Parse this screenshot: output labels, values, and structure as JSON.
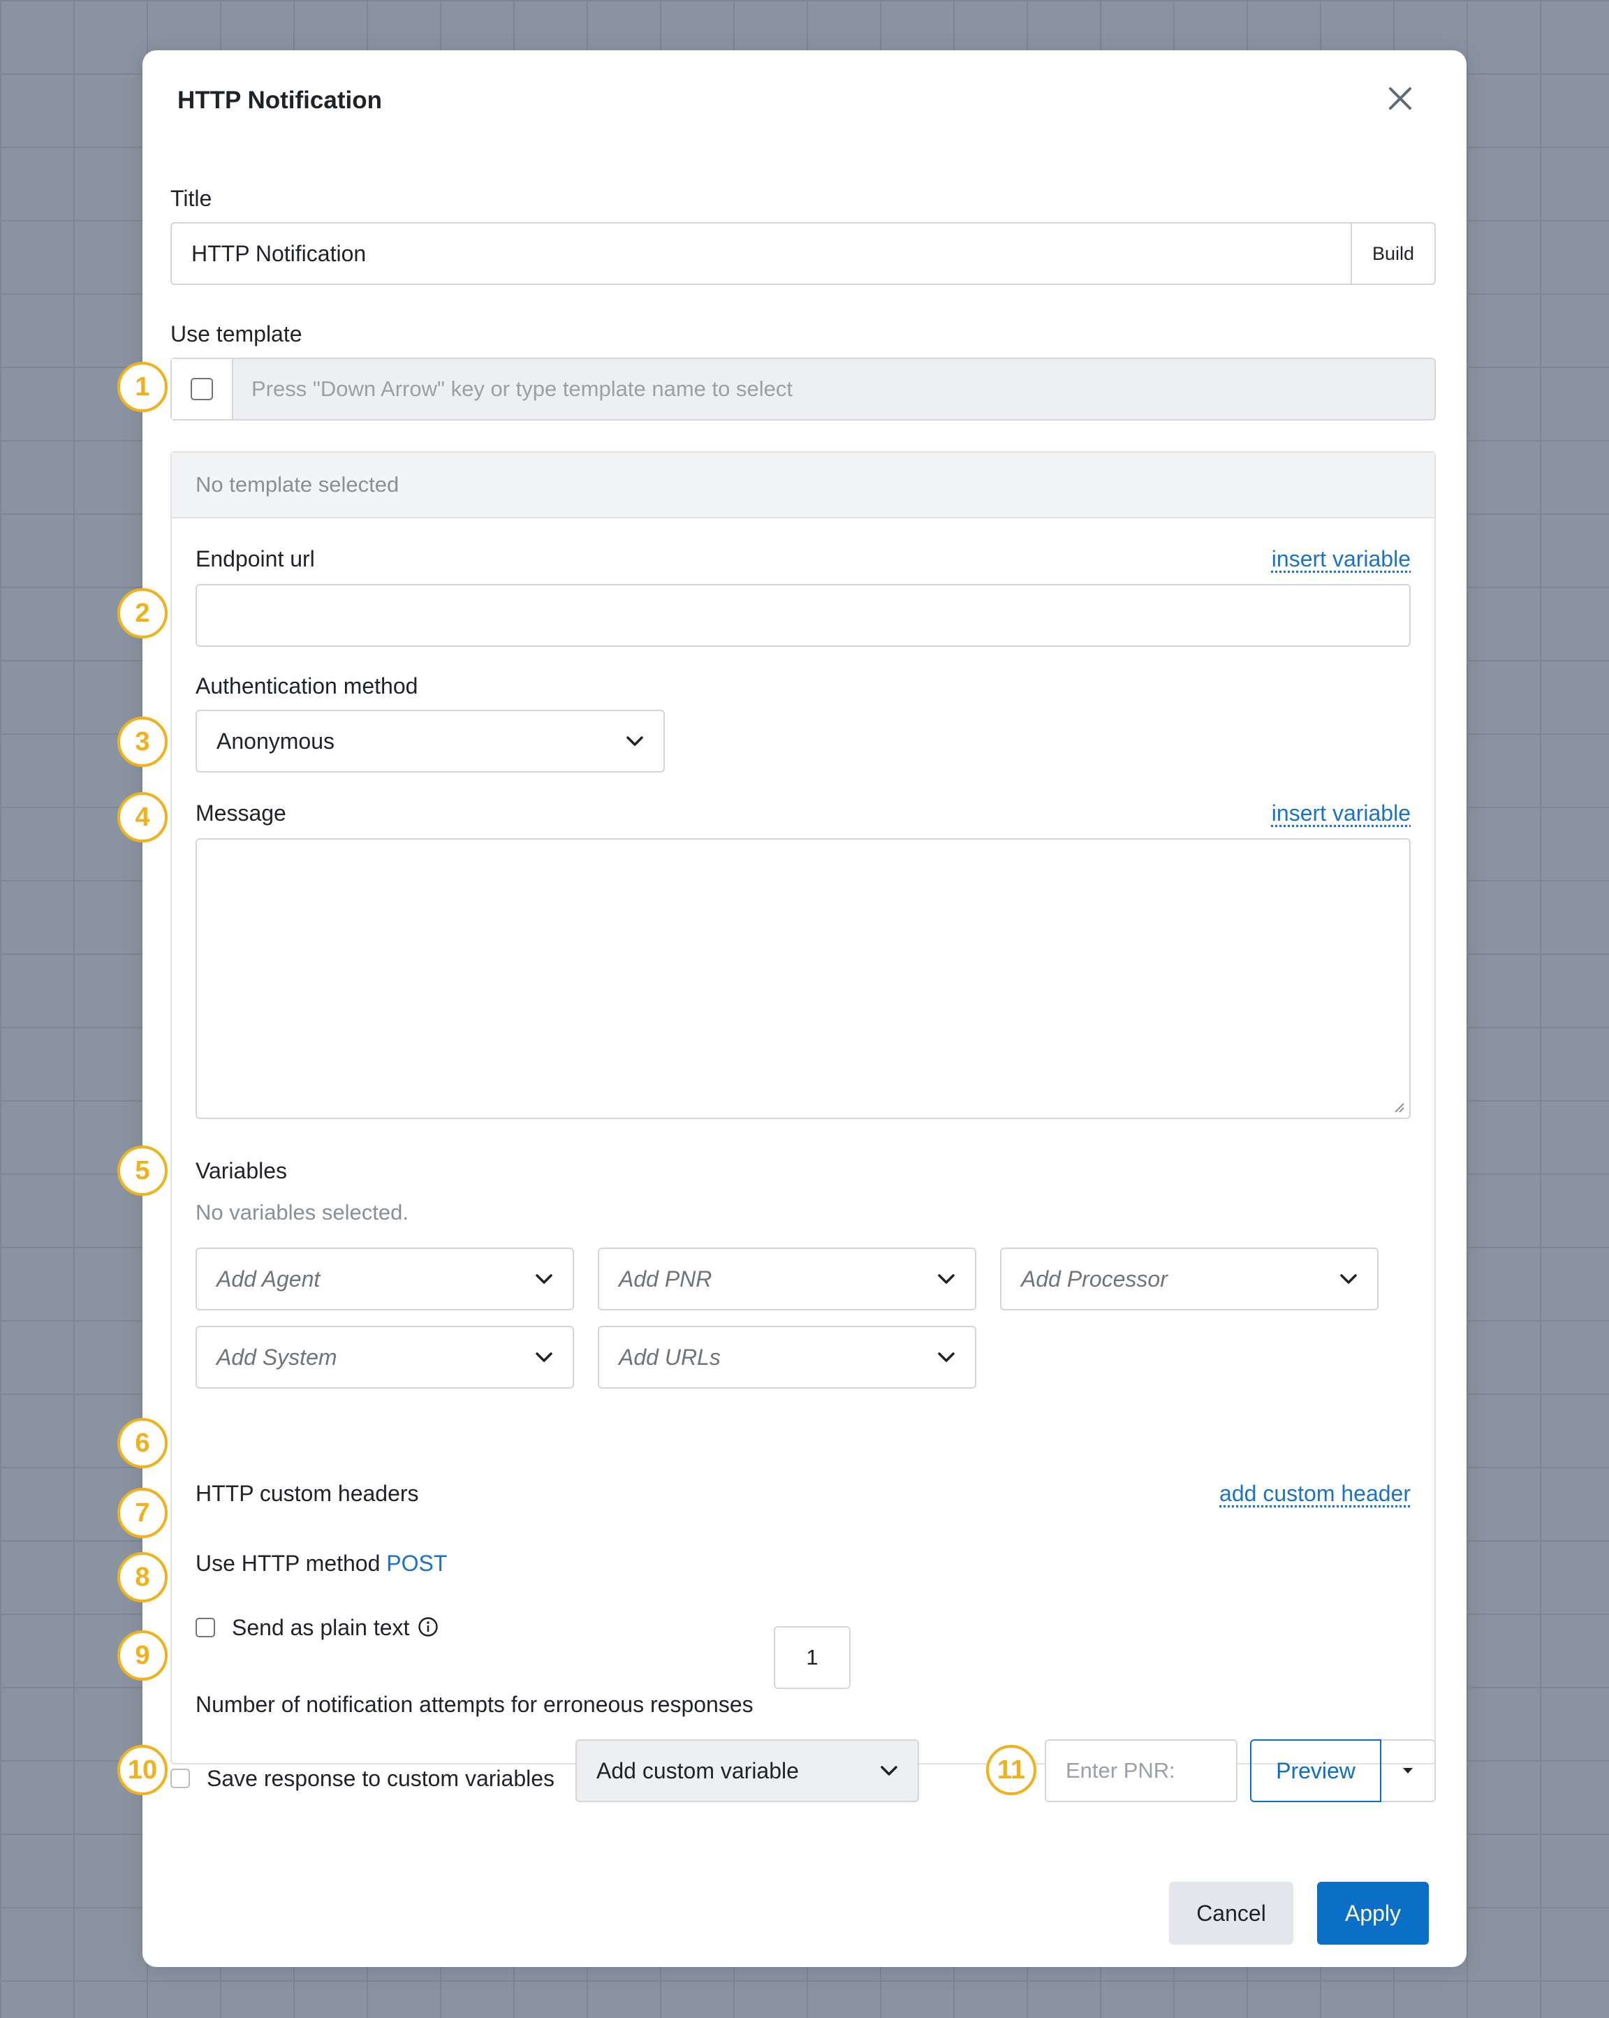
{
  "dialog": {
    "title": "HTTP Notification",
    "close_icon": "close-icon"
  },
  "title_field": {
    "label": "Title",
    "value": "HTTP Notification",
    "build_label": "Build"
  },
  "template": {
    "label": "Use template",
    "placeholder": "Press \"Down Arrow\" key or type template name to select",
    "none_selected": "No template selected"
  },
  "endpoint": {
    "label": "Endpoint url",
    "insert_variable": "insert variable",
    "value": ""
  },
  "auth": {
    "label": "Authentication method",
    "selected": "Anonymous"
  },
  "message": {
    "label": "Message",
    "insert_variable": "insert variable",
    "value": ""
  },
  "variables": {
    "label": "Variables",
    "empty_text": "No variables selected.",
    "dropdowns": [
      "Add Agent",
      "Add PNR",
      "Add Processor",
      "Add System",
      "Add URLs"
    ]
  },
  "headers": {
    "label": "HTTP custom headers",
    "add_label": "add custom header"
  },
  "http_method": {
    "prefix": "Use HTTP method",
    "method": "POST"
  },
  "plain_text": {
    "label": "Send as plain text"
  },
  "attempts": {
    "label": "Number of notification attempts for erroneous responses",
    "value": "1"
  },
  "save_response": {
    "label": "Save response to custom variables",
    "select": "Add custom variable"
  },
  "preview": {
    "pnr_placeholder": "Enter PNR:",
    "button": "Preview"
  },
  "footer": {
    "cancel": "Cancel",
    "apply": "Apply"
  },
  "badges": [
    "1",
    "2",
    "3",
    "4",
    "5",
    "6",
    "7",
    "8",
    "9",
    "10",
    "11"
  ],
  "colors": {
    "accent": "#0b6fc6",
    "badge": "#f0b11c",
    "link": "#1a73c8"
  }
}
